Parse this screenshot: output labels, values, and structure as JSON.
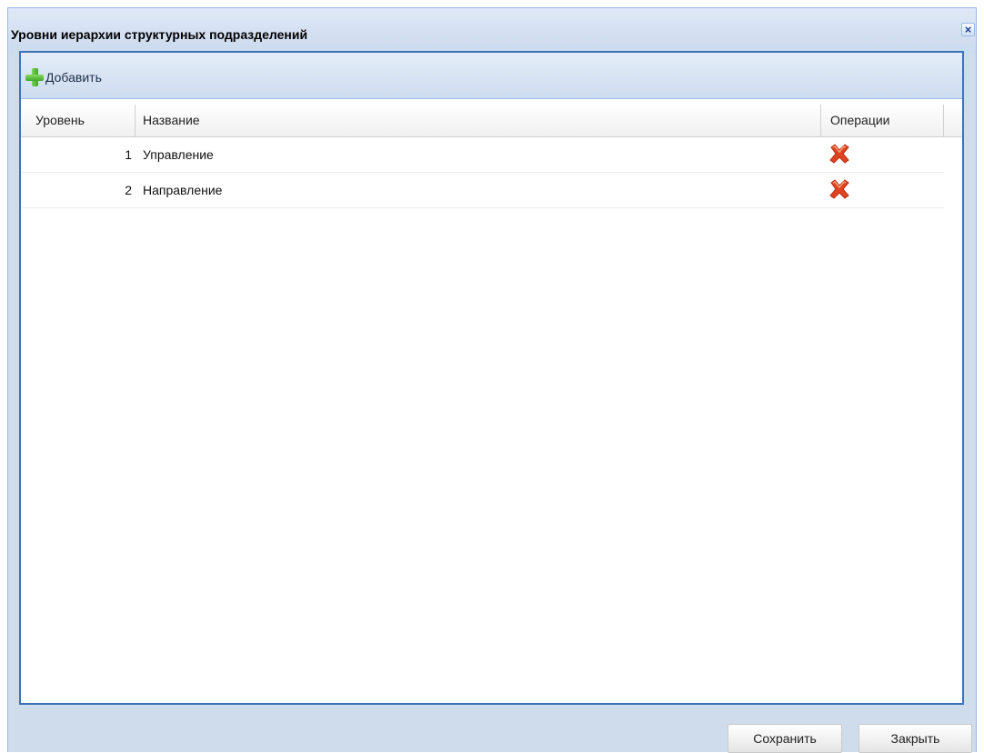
{
  "window": {
    "title": "Уровни иерархии структурных подразделений",
    "close_icon": "close-icon"
  },
  "toolbar": {
    "add_label": "Добавить",
    "add_icon": "plus-icon"
  },
  "grid": {
    "columns": [
      "Уровень",
      "Название",
      "Операции"
    ],
    "rows": [
      {
        "level": "1",
        "name": "Управление",
        "operation_icon": "delete-icon"
      },
      {
        "level": "2",
        "name": "Направление",
        "operation_icon": "delete-icon"
      }
    ]
  },
  "footer": {
    "save_label": "Сохранить",
    "close_label": "Закрыть"
  },
  "colors": {
    "title_bg": "#cbdaee",
    "panel_border": "#3e72b7",
    "add_icon_green": "#3ea82a",
    "delete_icon_red": "#e0431f"
  }
}
